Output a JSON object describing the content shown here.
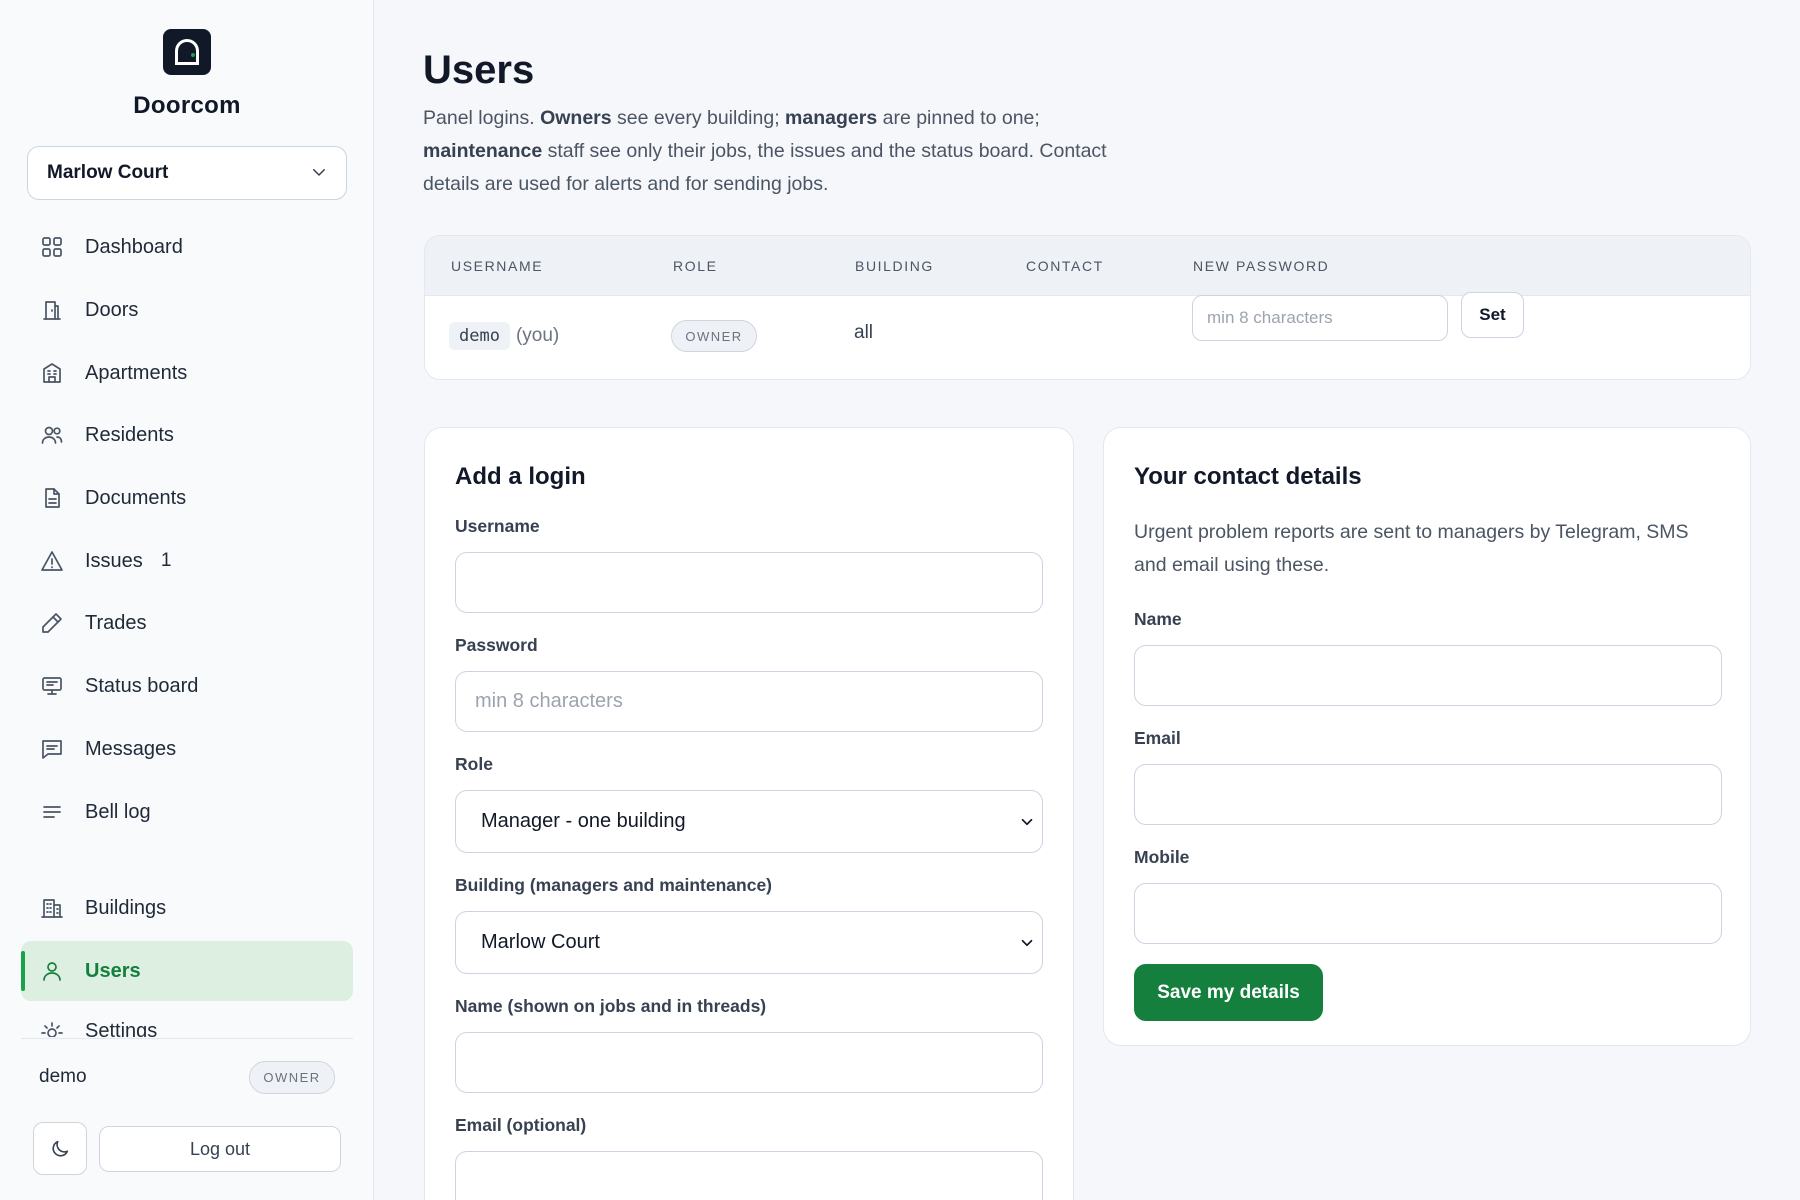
{
  "app": {
    "name": "Doorcom",
    "logo_icon": "door-logo-icon"
  },
  "sidebar": {
    "building_select": "Marlow Court",
    "items": [
      {
        "label": "Dashboard",
        "icon": "grid-icon"
      },
      {
        "label": "Doors",
        "icon": "door-icon"
      },
      {
        "label": "Apartments",
        "icon": "apartment-icon"
      },
      {
        "label": "Residents",
        "icon": "people-icon"
      },
      {
        "label": "Documents",
        "icon": "document-icon"
      },
      {
        "label": "Issues",
        "icon": "warning-icon",
        "count": "1"
      },
      {
        "label": "Trades",
        "icon": "pencil-icon"
      },
      {
        "label": "Status board",
        "icon": "monitor-icon"
      },
      {
        "label": "Messages",
        "icon": "message-icon"
      },
      {
        "label": "Bell log",
        "icon": "list-icon"
      },
      {
        "label": "Buildings",
        "icon": "building-icon"
      },
      {
        "label": "Users",
        "icon": "user-icon",
        "active": true
      },
      {
        "label": "Settings",
        "icon": "sun-gear-icon"
      }
    ],
    "user": {
      "name": "demo",
      "role_badge": "OWNER"
    },
    "logout_label": "Log out",
    "theme_icon": "moon-icon"
  },
  "main": {
    "title": "Users",
    "intro": {
      "p1": "Panel logins. ",
      "b1": "Owners",
      "p2": " see every building; ",
      "b2": "managers",
      "p3": " are pinned to one; ",
      "b3": "maintenance",
      "p4": " staff see only their jobs, the issues and the status board. Contact details are used for alerts and for sending jobs."
    },
    "table": {
      "headers": [
        "USERNAME",
        "ROLE",
        "BUILDING",
        "CONTACT",
        "NEW PASSWORD"
      ],
      "rows": [
        {
          "username": "demo",
          "you": "(you)",
          "role": "OWNER",
          "building": "all",
          "contact": "",
          "password_placeholder": "min 8 characters",
          "set_label": "Set"
        }
      ]
    },
    "add_login": {
      "title": "Add a login",
      "username_label": "Username",
      "username_value": "",
      "password_label": "Password",
      "password_placeholder": "min 8 characters",
      "role_label": "Role",
      "role_value": "Manager - one building",
      "building_label": "Building (managers and maintenance)",
      "building_value": "Marlow Court",
      "name_label": "Name (shown on jobs and in threads)",
      "name_value": "",
      "email_label": "Email (optional)",
      "email_value": ""
    },
    "contact": {
      "title": "Your contact details",
      "description": "Urgent problem reports are sent to managers by Telegram, SMS and email using these.",
      "name_label": "Name",
      "name_value": "",
      "email_label": "Email",
      "email_value": "",
      "mobile_label": "Mobile",
      "mobile_value": "",
      "save_label": "Save my details"
    }
  },
  "colors": {
    "accent": "#15803d",
    "active_bg": "#dcefe1",
    "sidebar_bg": "#f8fafc",
    "page_bg": "#f5f7fa"
  }
}
